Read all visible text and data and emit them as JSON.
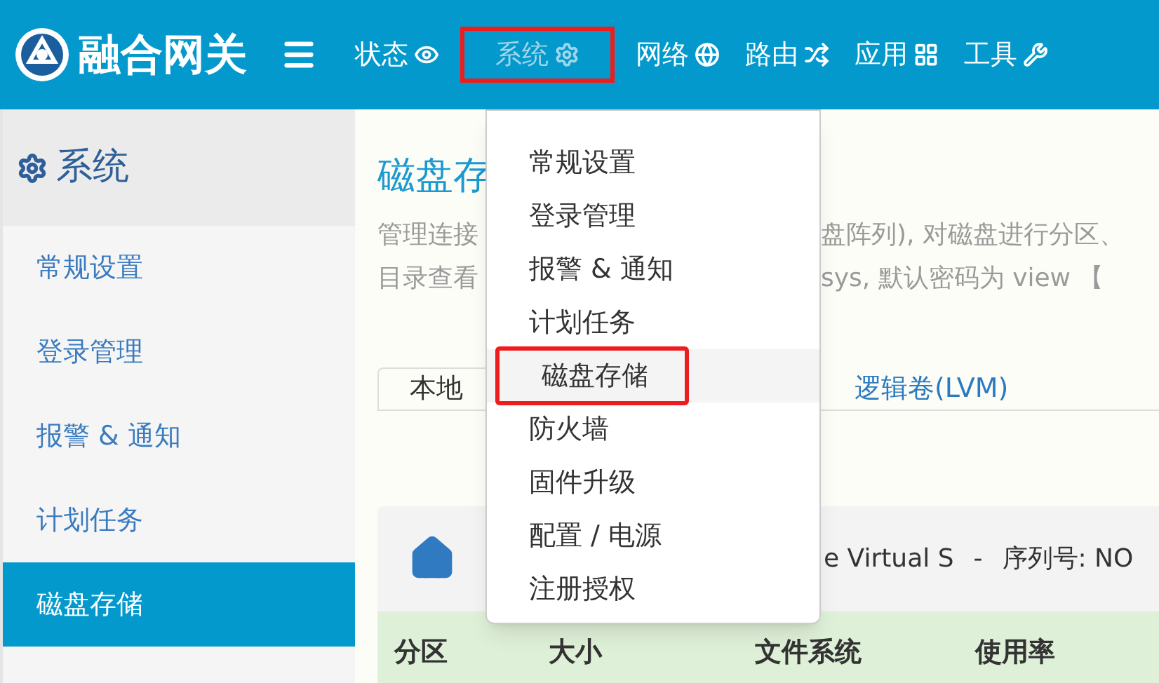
{
  "header": {
    "brand": "融合网关",
    "nav": [
      {
        "label": "状态",
        "highlighted": false
      },
      {
        "label": "系统",
        "highlighted": true
      },
      {
        "label": "网络",
        "highlighted": false
      },
      {
        "label": "路由",
        "highlighted": false
      },
      {
        "label": "应用",
        "highlighted": false
      },
      {
        "label": "工具",
        "highlighted": false
      }
    ]
  },
  "dropdown": {
    "items": [
      {
        "label": "常规设置",
        "highlighted": false
      },
      {
        "label": "登录管理",
        "highlighted": false
      },
      {
        "label": "报警 & 通知",
        "highlighted": false
      },
      {
        "label": "计划任务",
        "highlighted": false
      },
      {
        "label": "磁盘存储",
        "highlighted": true
      },
      {
        "label": "防火墙",
        "highlighted": false
      },
      {
        "label": "固件升级",
        "highlighted": false
      },
      {
        "label": "配置 / 电源",
        "highlighted": false
      },
      {
        "label": "注册授权",
        "highlighted": false
      }
    ]
  },
  "sidebar": {
    "title": "系统",
    "items": [
      {
        "label": "常规设置",
        "selected": false
      },
      {
        "label": "登录管理",
        "selected": false
      },
      {
        "label": "报警 & 通知",
        "selected": false
      },
      {
        "label": "计划任务",
        "selected": false
      },
      {
        "label": "磁盘存储",
        "selected": true
      }
    ]
  },
  "main": {
    "title": "磁盘存",
    "description": [
      [
        "管理连接",
        "盘阵列), 对磁盘进行分区、"
      ],
      [
        "目录查看",
        "sys, 默认密码为 view 【"
      ]
    ],
    "tabs": [
      {
        "label": "本地",
        "selected": true
      },
      {
        "label": "逻辑卷(LVM)",
        "selected": false
      }
    ],
    "disk_header": {
      "model": "e Virtual S",
      "separator": "-",
      "serial": "序列号: NO"
    },
    "table": {
      "columns": [
        "分区",
        "大小",
        "文件系统",
        "使用率"
      ]
    }
  }
}
